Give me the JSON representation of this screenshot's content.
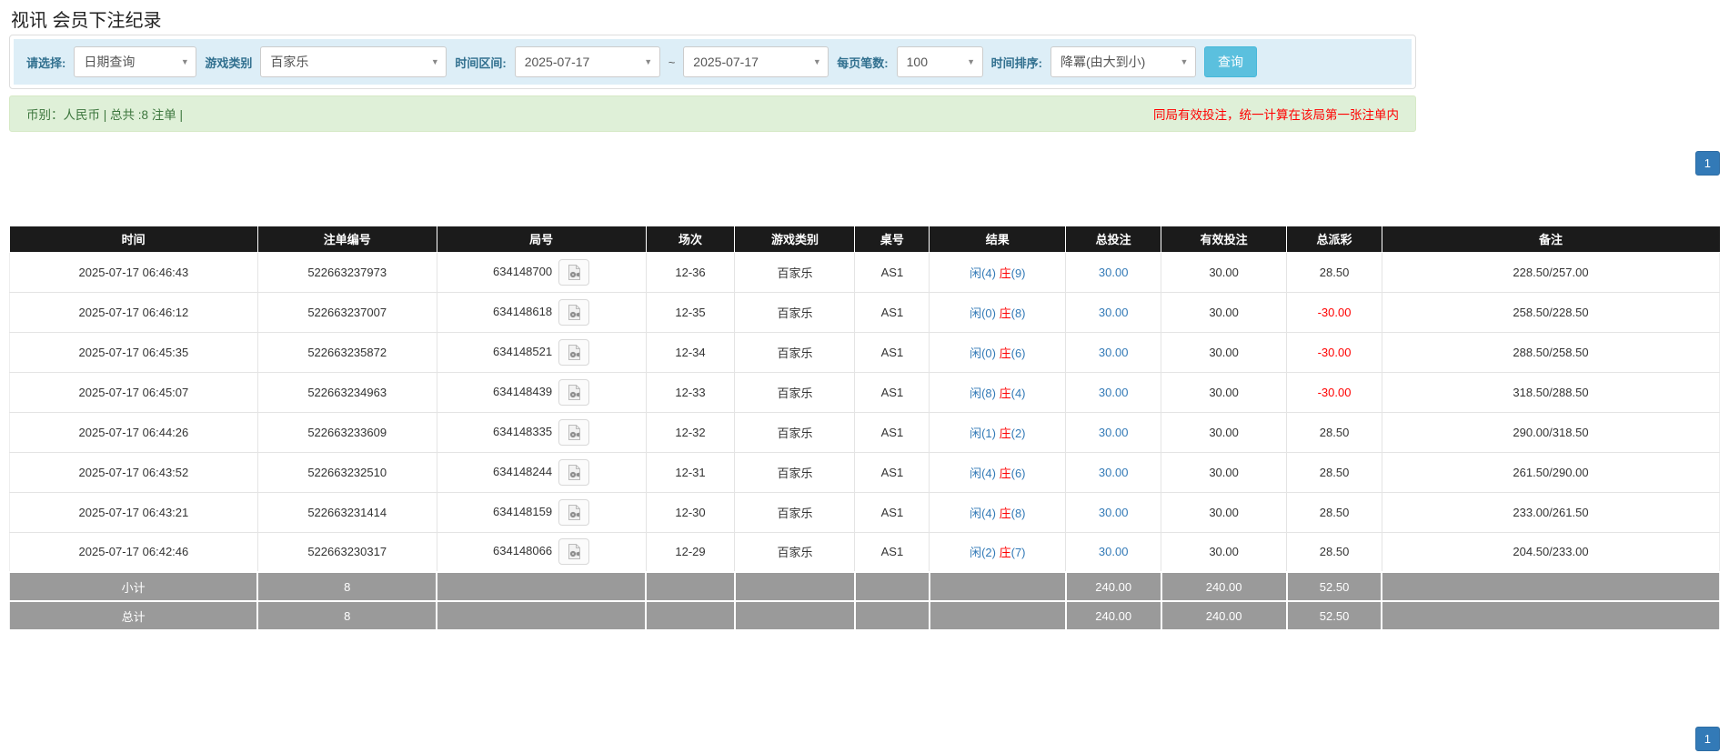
{
  "page": {
    "title": "视讯 会员下注纪录"
  },
  "filters": {
    "select_label": "请选择:",
    "select_value": "日期查询",
    "game_type_label": "游戏类别",
    "game_type_value": "百家乐",
    "time_range_label": "时间区间:",
    "date_from": "2025-07-17",
    "tilde": "~",
    "date_to": "2025-07-17",
    "page_size_label": "每页笔数:",
    "page_size_value": "100",
    "sort_label": "时间排序:",
    "sort_value": "降冪(由大到小)",
    "query_button_label": "查询"
  },
  "summary_bar": {
    "left_text": "币别：人民币 | 总共 :8 注单 |",
    "right_notice": "同局有效投注，统一计算在该局第一张注单内"
  },
  "pagination": {
    "page": "1"
  },
  "icons": {
    "dropdown": "chevron-down-icon",
    "round_video": "video-file-icon"
  },
  "colors": {
    "accent_blue": "#337ab7",
    "query_button": "#5bc0de",
    "header_black": "#1b1b1b",
    "green_bar_bg": "#dff0d8",
    "green_text": "#3c763d",
    "notice_red": "#ff0000",
    "sum_row_gray": "#9a9a9a",
    "filter_bg": "#ddeef7"
  },
  "table": {
    "headers": [
      "时间",
      "注单编号",
      "局号",
      "场次",
      "游戏类别",
      "桌号",
      "结果",
      "总投注",
      "有效投注",
      "总派彩",
      "备注"
    ],
    "rows": [
      {
        "time": "2025-07-17 06:46:43",
        "bet_id": "522663237973",
        "round_id": "634148700",
        "session": "12-36",
        "game": "百家乐",
        "table_no": "AS1",
        "result_player": "闲(4)",
        "result_banker": "庄",
        "result_banker_num": "(9)",
        "total_bet": "30.00",
        "valid_bet": "30.00",
        "payout": "28.50",
        "remark": "228.50/257.00"
      },
      {
        "time": "2025-07-17 06:46:12",
        "bet_id": "522663237007",
        "round_id": "634148618",
        "session": "12-35",
        "game": "百家乐",
        "table_no": "AS1",
        "result_player": "闲(0)",
        "result_banker": "庄",
        "result_banker_num": "(8)",
        "total_bet": "30.00",
        "valid_bet": "30.00",
        "payout": "-30.00",
        "remark": "258.50/228.50"
      },
      {
        "time": "2025-07-17 06:45:35",
        "bet_id": "522663235872",
        "round_id": "634148521",
        "session": "12-34",
        "game": "百家乐",
        "table_no": "AS1",
        "result_player": "闲(0)",
        "result_banker": "庄",
        "result_banker_num": "(6)",
        "total_bet": "30.00",
        "valid_bet": "30.00",
        "payout": "-30.00",
        "remark": "288.50/258.50"
      },
      {
        "time": "2025-07-17 06:45:07",
        "bet_id": "522663234963",
        "round_id": "634148439",
        "session": "12-33",
        "game": "百家乐",
        "table_no": "AS1",
        "result_player": "闲(8)",
        "result_banker": "庄",
        "result_banker_num": "(4)",
        "total_bet": "30.00",
        "valid_bet": "30.00",
        "payout": "-30.00",
        "remark": "318.50/288.50"
      },
      {
        "time": "2025-07-17 06:44:26",
        "bet_id": "522663233609",
        "round_id": "634148335",
        "session": "12-32",
        "game": "百家乐",
        "table_no": "AS1",
        "result_player": "闲(1)",
        "result_banker": "庄",
        "result_banker_num": "(2)",
        "total_bet": "30.00",
        "valid_bet": "30.00",
        "payout": "28.50",
        "remark": "290.00/318.50"
      },
      {
        "time": "2025-07-17 06:43:52",
        "bet_id": "522663232510",
        "round_id": "634148244",
        "session": "12-31",
        "game": "百家乐",
        "table_no": "AS1",
        "result_player": "闲(4)",
        "result_banker": "庄",
        "result_banker_num": "(6)",
        "total_bet": "30.00",
        "valid_bet": "30.00",
        "payout": "28.50",
        "remark": "261.50/290.00"
      },
      {
        "time": "2025-07-17 06:43:21",
        "bet_id": "522663231414",
        "round_id": "634148159",
        "session": "12-30",
        "game": "百家乐",
        "table_no": "AS1",
        "result_player": "闲(4)",
        "result_banker": "庄",
        "result_banker_num": "(8)",
        "total_bet": "30.00",
        "valid_bet": "30.00",
        "payout": "28.50",
        "remark": "233.00/261.50"
      },
      {
        "time": "2025-07-17 06:42:46",
        "bet_id": "522663230317",
        "round_id": "634148066",
        "session": "12-29",
        "game": "百家乐",
        "table_no": "AS1",
        "result_player": "闲(2)",
        "result_banker": "庄",
        "result_banker_num": "(7)",
        "total_bet": "30.00",
        "valid_bet": "30.00",
        "payout": "28.50",
        "remark": "204.50/233.00"
      }
    ],
    "subtotal": {
      "label": "小计",
      "count": "8",
      "total_bet": "240.00",
      "valid_bet": "240.00",
      "payout": "52.50"
    },
    "total": {
      "label": "总计",
      "count": "8",
      "total_bet": "240.00",
      "valid_bet": "240.00",
      "payout": "52.50"
    }
  }
}
